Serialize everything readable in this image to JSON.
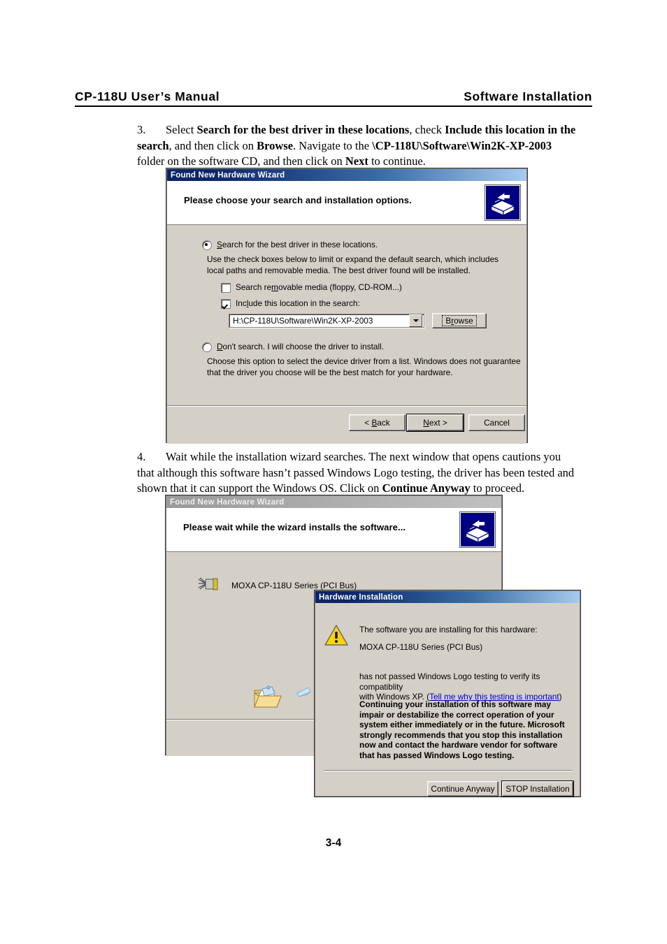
{
  "page": {
    "header_left": "CP-118U  User’s  Manual",
    "header_right": "Software  Installation",
    "page_number": "3-4"
  },
  "steps": [
    {
      "number": "3.",
      "segments": [
        {
          "text": "Select ",
          "bold": false
        },
        {
          "text": "Search for the best driver in these locations",
          "bold": true
        },
        {
          "text": ", check ",
          "bold": false
        },
        {
          "text": "Include this location in the search",
          "bold": true
        },
        {
          "text": ", and then click on ",
          "bold": false
        },
        {
          "text": "Browse",
          "bold": true
        },
        {
          "text": ". Navigate to the ",
          "bold": false
        },
        {
          "text": "\\CP-118U\\Software\\Win2K-XP-2003",
          "bold": true
        },
        {
          "text": " folder on the software CD, and then click on ",
          "bold": false
        },
        {
          "text": "Next",
          "bold": true
        },
        {
          "text": " to continue.",
          "bold": false
        }
      ]
    },
    {
      "number": "4.",
      "segments": [
        {
          "text": "Wait while the installation wizard searches. The next window that opens cautions you that although this software hasn’t passed Windows Logo testing, the driver has been tested and shown that it can support the Windows OS. Click on ",
          "bold": false
        },
        {
          "text": "Continue Anyway",
          "bold": true
        },
        {
          "text": " to proceed.",
          "bold": false
        }
      ]
    }
  ],
  "dialog_search": {
    "title": "Found New Hardware Wizard",
    "heading": "Please choose your search and installation options.",
    "icon": "wizard-box-icon",
    "option_search": {
      "label": "Search for the best driver in these locations.",
      "mnemonic": "S",
      "checked": true,
      "description": "Use the check boxes below to limit or expand the default search, which includes local paths and removable media. The best driver found will be installed."
    },
    "checkbox_removable": {
      "label": "Search removable media (floppy, CD-ROM...)",
      "checked": false
    },
    "checkbox_include": {
      "label": "Include this location in the search:",
      "checked": true
    },
    "location_value": "H:\\CP-118U\\Software\\Win2K-XP-2003",
    "browse_label": "Browse",
    "option_dont_search": {
      "label": "Don't search. I will choose the driver to install.",
      "checked": false,
      "description": "Choose this option to select the device driver from a list.  Windows does not guarantee that the driver you choose will be the best match for your hardware."
    },
    "buttons": {
      "back": "< Back",
      "next": "Next >",
      "cancel": "Cancel"
    }
  },
  "dialog_install": {
    "title": "Found New Hardware Wizard",
    "heading": "Please wait while the wizard installs the software...",
    "icon": "wizard-box-icon",
    "device_name": "MOXA CP-118U Series (PCI Bus)",
    "device_icon": "serial-connector-icon",
    "animation": {
      "folder_icon": "open-folder-icon",
      "document_icon": "flying-document-icon"
    }
  },
  "dialog_hardware": {
    "title": "Hardware Installation",
    "warn_icon": "warning-triangle-icon",
    "line1": "The software you are installing for this hardware:",
    "line2": "MOXA CP-118U Series (PCI Bus)",
    "line3_a": "has not passed Windows Logo testing to verify its compatiblity",
    "line3_b": "with Windows XP. (",
    "link_text": "Tell me why this testing is important",
    "line3_c": ")",
    "warning_paragraph": "Continuing your installation of this software may impair or destabilize the correct operation of your system either immediately or in the future. Microsoft strongly recommends that you stop this installation now and contact the hardware vendor for software that has passed Windows Logo testing.",
    "buttons": {
      "continue": "Continue Anyway",
      "stop": "STOP Installation"
    }
  },
  "colors": {
    "titlebar_active_start": "#0a246a",
    "titlebar_active_end": "#a6caf0",
    "dialog_face": "#d4d0c8",
    "wizard_icon_bg": "#000080",
    "link": "#0000c8",
    "warning_yellow": "#ffd400"
  }
}
